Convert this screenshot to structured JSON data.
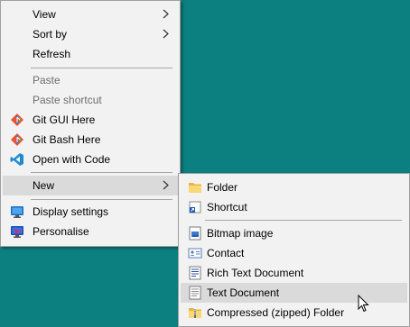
{
  "main_menu": {
    "view": "View",
    "sort_by": "Sort by",
    "refresh": "Refresh",
    "paste": "Paste",
    "paste_shortcut": "Paste shortcut",
    "git_gui": "Git GUI Here",
    "git_bash": "Git Bash Here",
    "open_with_code": "Open with Code",
    "new": "New",
    "display_settings": "Display settings",
    "personalise": "Personalise"
  },
  "new_submenu": {
    "folder": "Folder",
    "shortcut": "Shortcut",
    "bitmap_image": "Bitmap image",
    "contact": "Contact",
    "rich_text_document": "Rich Text Document",
    "text_document": "Text Document",
    "compressed_folder": "Compressed (zipped) Folder"
  },
  "colors": {
    "desktop_background": "#0c8080",
    "menu_background": "#f2f2f2",
    "hover_background": "#dadada",
    "disabled_text": "#6d6d6d"
  }
}
